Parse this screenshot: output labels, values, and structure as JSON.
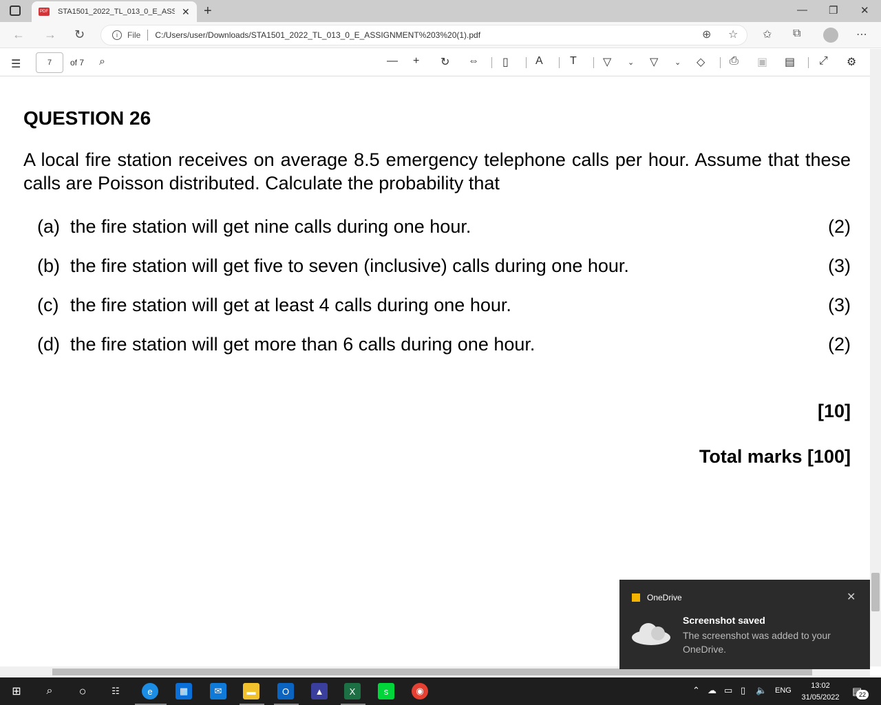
{
  "browser": {
    "tab_title": "STA1501_2022_TL_013_0_E_ASSIGNMENT%203%20(1).pdf",
    "pdf_badge": "PDF",
    "url_scheme_label": "File",
    "url": "C:/Users/user/Downloads/STA1501_2022_TL_013_0_E_ASSIGNMENT%203%20(1).pdf"
  },
  "pdf_toolbar": {
    "current_page": "7",
    "page_total": "of 7"
  },
  "document": {
    "question_title": "QUESTION 26",
    "intro": "A local fire station receives on average 8.5 emergency telephone calls per hour.  Assume that these calls are Poisson distributed.  Calculate the probability that",
    "parts": [
      {
        "letter": "(a)",
        "text": "the fire station will get nine calls during one hour.",
        "marks": "(2)"
      },
      {
        "letter": "(b)",
        "text": "the fire station will get five to seven (inclusive) calls during one hour.",
        "marks": "(3)"
      },
      {
        "letter": "(c)",
        "text": "the fire station will get at least 4 calls during one hour.",
        "marks": "(3)"
      },
      {
        "letter": "(d)",
        "text": "the fire station will get more than 6 calls during one hour.",
        "marks": "(2)"
      }
    ],
    "section_total": "[10]",
    "total_marks": "Total marks  [100]"
  },
  "toast": {
    "app": "OneDrive",
    "title": "Screenshot saved",
    "body": "The screenshot was added to your OneDrive."
  },
  "taskbar": {
    "language": "ENG",
    "time": "13:02",
    "date": "31/05/2022",
    "notification_count": "22"
  }
}
